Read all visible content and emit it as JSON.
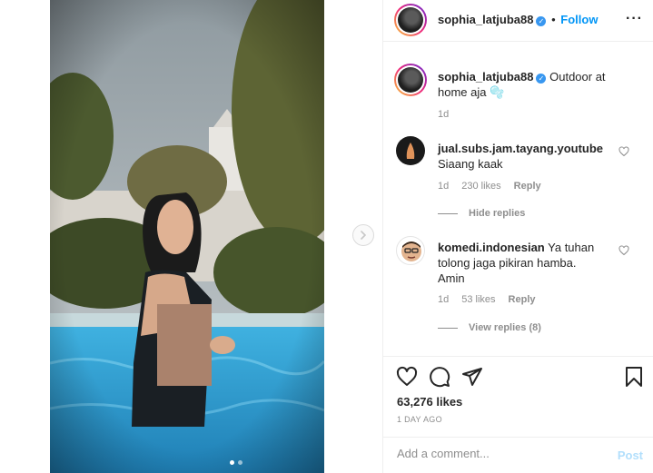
{
  "post": {
    "username": "sophia_latjuba88",
    "follow_label": "Follow",
    "separator": "•",
    "caption": "Outdoor at home aja",
    "caption_emoji": "🫧",
    "caption_age": "1d",
    "likes": "63,276 likes",
    "posted": "1 DAY AGO",
    "carousel": {
      "count": 2,
      "active_index": 0
    }
  },
  "comments": [
    {
      "username": "jual.subs.jam.tayang.youtube",
      "text": "Siaang kaak",
      "age": "1d",
      "likes": "230 likes",
      "reply_label": "Reply",
      "replies_toggle": "Hide replies"
    },
    {
      "username": "komedi.indonesian",
      "text_line1": "Ya tuhan",
      "text_line2": "tolong jaga pikiran hamba.",
      "text_line3": "Amin",
      "age": "1d",
      "likes": "53 likes",
      "reply_label": "Reply",
      "replies_toggle": "View replies (8)"
    }
  ],
  "composer": {
    "placeholder": "Add a comment...",
    "post_label": "Post"
  },
  "icons": {
    "header_more": "more-options-icon",
    "like": "heart-icon",
    "comment": "comment-icon",
    "share": "send-icon",
    "save": "bookmark-icon",
    "next": "chevron-right-icon"
  },
  "colors": {
    "link": "#0095f6",
    "muted": "#8e8e8e",
    "verified": "#3897f0",
    "pool": "#2a93c9"
  }
}
